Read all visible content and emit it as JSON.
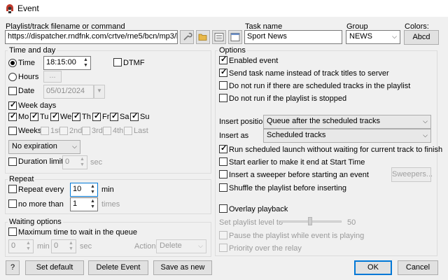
{
  "window": {
    "title": "Event",
    "app_icon": "app-icon"
  },
  "playlist": {
    "label": "Playlist/track filename or command",
    "value": "https://dispatcher.rndfnk.com/crtve/rne5/bcn/mp3/hic"
  },
  "task": {
    "label": "Task name",
    "value": "Sport News"
  },
  "group": {
    "label": "Group",
    "value": "NEWS"
  },
  "colors": {
    "label": "Colors:",
    "button": "Abcd"
  },
  "time_and_day": {
    "title": "Time and day",
    "time_label": "Time",
    "time_value": "18:15:00",
    "dtmf_label": "DTMF",
    "hours_label": "Hours",
    "hours_button": "...",
    "date_label": "Date",
    "date_value": "05/01/2024",
    "week_days_label": "Week days",
    "days": [
      "Mo",
      "Tu",
      "We",
      "Th",
      "Fr",
      "Sa",
      "Su"
    ],
    "weeks_label": "Weeks",
    "weeks": [
      "1st",
      "2nd",
      "3rd",
      "4th",
      "Last"
    ],
    "expiration": "No expiration",
    "duration_label": "Duration limit",
    "duration_value": "0",
    "duration_unit": "sec"
  },
  "repeat": {
    "title": "Repeat",
    "every_label": "Repeat every",
    "every_value": "10",
    "every_unit": "min",
    "no_more_label": "no more than",
    "no_more_value": "1",
    "no_more_unit": "times"
  },
  "waiting": {
    "title": "Waiting options",
    "max_label": "Maximum time to wait in the queue",
    "min_value": "0",
    "min_unit": "min",
    "sec_value": "0",
    "sec_unit": "sec",
    "action_label": "Action",
    "action_value": "Delete"
  },
  "options": {
    "title": "Options",
    "enabled": "Enabled event",
    "send_task": "Send task name instead of track titles to server",
    "no_run_scheduled": "Do not run if there are scheduled tracks in the playlist",
    "no_run_stopped": "Do not run if the playlist is stopped",
    "insert_position_label": "Insert position",
    "insert_position_value": "Queue after the scheduled tracks",
    "insert_as_label": "Insert as",
    "insert_as_value": "Scheduled tracks",
    "run_without_waiting": "Run scheduled launch without waiting for current track to finish",
    "start_earlier": "Start earlier to make it end at Start Time",
    "insert_sweeper": "Insert a sweeper before starting an event",
    "sweepers_button": "Sweepers...",
    "shuffle": "Shuffle the playlist before inserting",
    "overlay": "Overlay playback",
    "set_level_label": "Set playlist level to",
    "level_value": "50",
    "pause": "Pause the playlist while event is playing",
    "priority": "Priority over the relay"
  },
  "footer": {
    "help": "?",
    "set_default": "Set default",
    "delete_event": "Delete Event",
    "save_as_new": "Save as new",
    "ok": "OK",
    "cancel": "Cancel"
  }
}
